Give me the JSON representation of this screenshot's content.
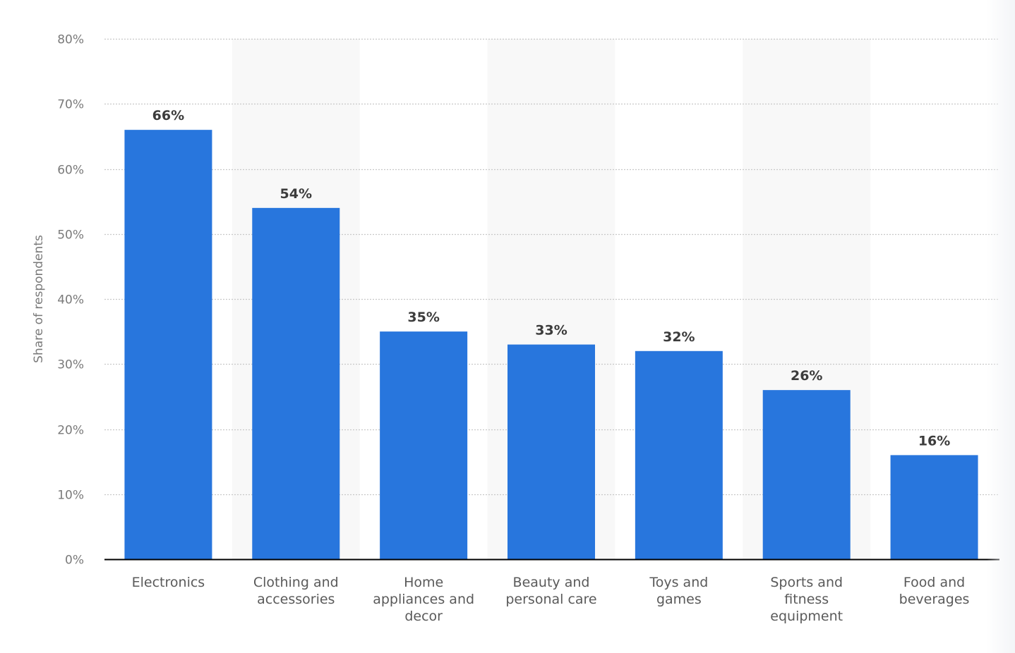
{
  "chart_data": {
    "type": "bar",
    "title": "",
    "xlabel": "",
    "ylabel": "Share of respondents",
    "categories": [
      [
        "Electronics"
      ],
      [
        "Clothing and",
        "accessories"
      ],
      [
        "Home",
        "appliances and",
        "decor"
      ],
      [
        "Beauty and",
        "personal care"
      ],
      [
        "Toys and",
        "games"
      ],
      [
        "Sports and",
        "fitness",
        "equipment"
      ],
      [
        "Food and",
        "beverages"
      ]
    ],
    "category_names": [
      "Electronics",
      "Clothing and accessories",
      "Home appliances and decor",
      "Beauty and personal care",
      "Toys and games",
      "Sports and fitness equipment",
      "Food and beverages"
    ],
    "values": [
      66,
      54,
      35,
      33,
      32,
      26,
      16
    ],
    "value_labels": [
      "66%",
      "54%",
      "35%",
      "33%",
      "32%",
      "26%",
      "16%"
    ],
    "ylim": [
      0,
      80
    ],
    "yticks": [
      0,
      10,
      20,
      30,
      40,
      50,
      60,
      70,
      80
    ],
    "ytick_labels": [
      "0%",
      "10%",
      "20%",
      "30%",
      "40%",
      "50%",
      "60%",
      "70%",
      "80%"
    ],
    "grid": true,
    "legend": "none",
    "colors": {
      "bar": "#2876dd",
      "band": "#f8f8f8",
      "grid": "#c8c8c8",
      "axis": "#000000",
      "tick_text": "#7a7a7a",
      "value_text": "#3c3c3c",
      "category_text": "#5a5a5a"
    }
  }
}
